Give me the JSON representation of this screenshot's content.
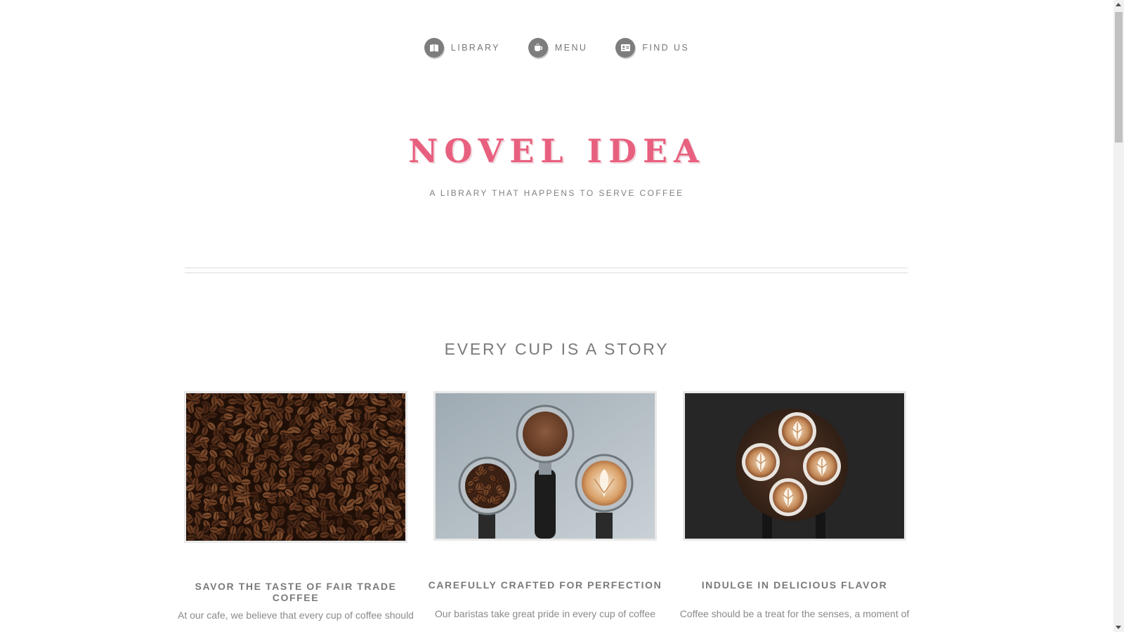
{
  "nav": {
    "items": [
      {
        "label": "LIBRARY",
        "icon": "book-icon"
      },
      {
        "label": "MENU",
        "icon": "coffee-cup-icon"
      },
      {
        "label": "FIND US",
        "icon": "address-card-icon"
      }
    ]
  },
  "hero": {
    "title": "NOVEL IDEA",
    "subtitle": "A LIBRARY THAT HAPPENS TO SERVE COFFEE"
  },
  "section": {
    "heading": "EVERY CUP IS A STORY"
  },
  "cards": [
    {
      "title": "SAVOR THE TASTE OF FAIR TRADE COFFEE",
      "text": "At our cafe, we believe that every cup of coffee should",
      "image": "coffee-beans-photo"
    },
    {
      "title": "CAREFULLY CRAFTED FOR PERFECTION",
      "text": "Our baristas take great pride in every cup of coffee",
      "image": "espresso-portafilters-photo"
    },
    {
      "title": "INDULGE IN DELICIOUS FLAVOR",
      "text": "Coffee should be a treat for the senses, a moment of",
      "image": "latte-art-cups-photo"
    }
  ],
  "colors": {
    "accent": "#e8607f",
    "text": "#7a7a7a",
    "icon_bg": "#7d7d7d"
  }
}
